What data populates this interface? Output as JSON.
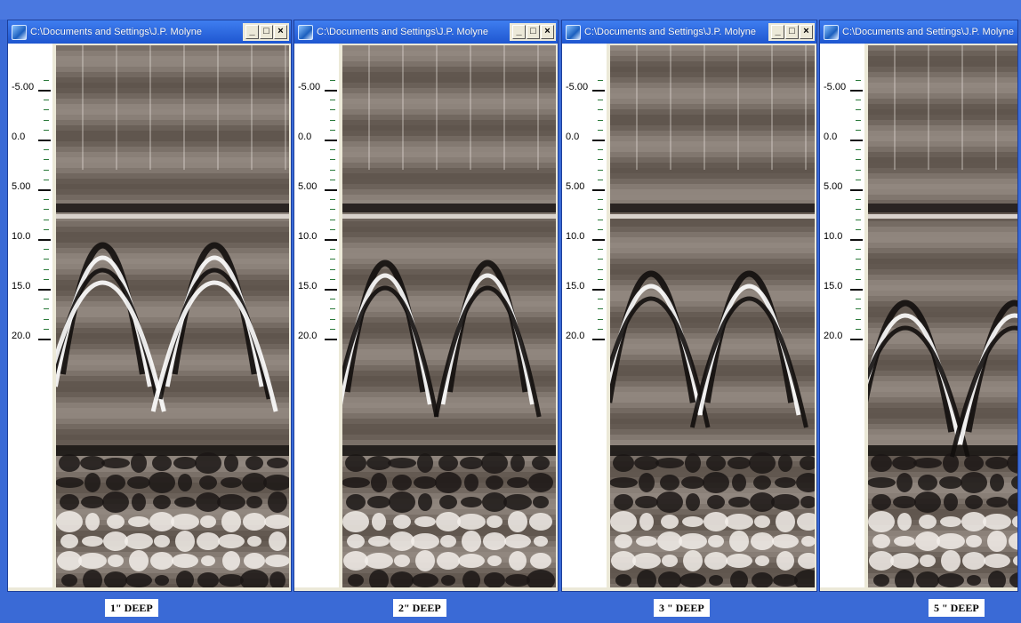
{
  "windows": [
    {
      "title": "C:\\Documents and Settings\\J.P. Molyne",
      "caption": "1\" DEEP"
    },
    {
      "title": "C:\\Documents and Settings\\J.P. Molyne",
      "caption": "2\" DEEP"
    },
    {
      "title": "C:\\Documents and Settings\\J.P. Molyne",
      "caption": "3 \" DEEP"
    },
    {
      "title": "C:\\Documents and Settings\\J.P. Molyne",
      "caption": "5 \" DEEP"
    }
  ],
  "depth_axis": {
    "labels": [
      "-5.00",
      "0.0",
      "5.00",
      "10.0",
      "15.0",
      "20.0"
    ],
    "values": [
      -5,
      0,
      5,
      10,
      15,
      20
    ]
  },
  "buttons": {
    "minimize": "_",
    "maximize": "□",
    "close": "×"
  },
  "colors": {
    "desktop": "#3a6ad6",
    "titlebar": "#1e56d0",
    "ruler_tick": "#2a7a3a"
  }
}
